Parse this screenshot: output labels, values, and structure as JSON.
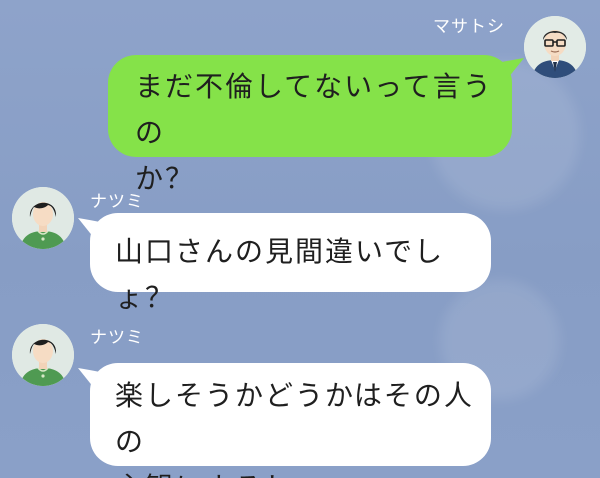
{
  "messages": [
    {
      "sender": "マサトシ",
      "side": "right",
      "text": "まだ不倫してないって言うの\nか？",
      "bubble_color": "#85e249"
    },
    {
      "sender": "ナツミ",
      "side": "left",
      "text": "山口さんの見間違いでしょ？",
      "bubble_color": "#ffffff"
    },
    {
      "sender": "ナツミ",
      "side": "left",
      "text": "楽しそうかどうかはその人の\n主観によるし",
      "bubble_color": "#ffffff"
    }
  ],
  "colors": {
    "background": "#8aa0c7",
    "name_text": "#ffffff"
  },
  "icons": {
    "masatoshi_avatar": "man-with-glasses-avatar-icon",
    "natsumi_avatar": "woman-short-hair-avatar-icon"
  }
}
